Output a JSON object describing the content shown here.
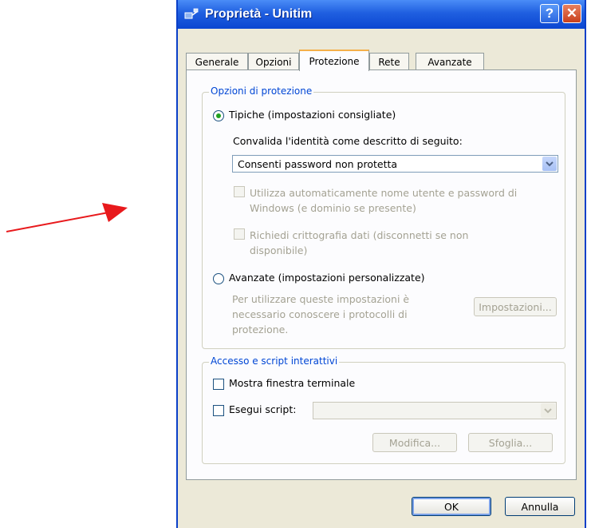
{
  "window": {
    "title": "Proprietà - Unitim",
    "help_symbol": "?",
    "close_symbol": "✕",
    "icon": "network-connection-icon"
  },
  "annotation": {
    "arrow_color": "#e8191c"
  },
  "tabs": [
    {
      "label": "Generale",
      "active": false
    },
    {
      "label": "Opzioni",
      "active": false
    },
    {
      "label": "Protezione",
      "active": true
    },
    {
      "label": "Rete",
      "active": false
    },
    {
      "label": "Avanzate",
      "active": false
    }
  ],
  "protection": {
    "legend": "Opzioni di protezione",
    "typical_label": "Tipiche (impostazioni consigliate)",
    "typical_selected": true,
    "validate_label": "Convalida l'identità come descritto di seguito:",
    "validate_selected": "Consenti password non protetta",
    "auto_credentials_label": "Utilizza automaticamente nome utente e password di Windows (e dominio se presente)",
    "auto_credentials_checked": false,
    "encryption_label": "Richiedi crittografia dati (disconnetti se non disponibile)",
    "encryption_checked": false,
    "advanced_label": "Avanzate (impostazioni personalizzate)",
    "advanced_selected": false,
    "advanced_help": "Per utilizzare queste impostazioni è necessario conoscere i protocolli di protezione.",
    "settings_button": "Impostazioni..."
  },
  "interactive": {
    "legend": "Accesso e script interattivi",
    "terminal_label": "Mostra finestra terminale",
    "terminal_checked": false,
    "script_label": "Esegui script:",
    "script_checked": false,
    "script_value": "",
    "edit_button": "Modifica...",
    "browse_button": "Sfoglia..."
  },
  "footer": {
    "ok_button": "OK",
    "cancel_button": "Annulla"
  },
  "colors": {
    "title_bar": "#0b46d1",
    "group_legend": "#0046d5",
    "active_tab_accent": "#f5b04a",
    "radio_dot": "#21a121"
  }
}
